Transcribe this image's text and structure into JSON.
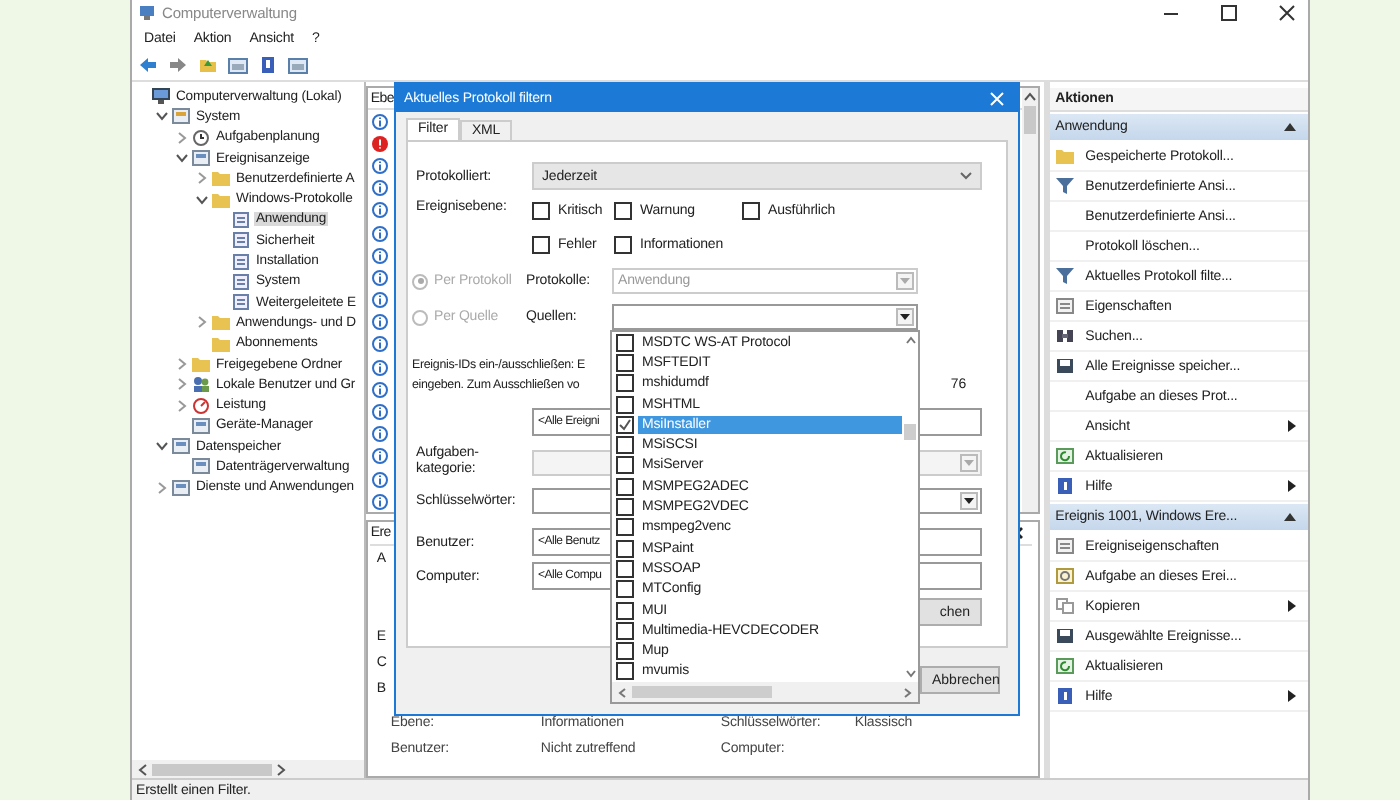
{
  "window": {
    "title": "Computerverwaltung"
  },
  "menu": [
    "Datei",
    "Aktion",
    "Ansicht",
    "?"
  ],
  "toolbar": [
    {
      "kind": "back"
    },
    {
      "kind": "forward"
    },
    {
      "kind": "folder"
    },
    {
      "kind": "console"
    },
    {
      "kind": "help"
    },
    {
      "kind": "console"
    }
  ],
  "tree": [
    {
      "label": "Computerverwaltung (Lokal)",
      "kind": "computer",
      "selected": false,
      "children": [
        {
          "label": "System",
          "kind": "tools",
          "expanded": true,
          "selected": false,
          "children": [
            {
              "label": "Aufgabenplanung",
              "kind": "clock",
              "expanded": false,
              "selected": false
            },
            {
              "label": "Ereignisanzeige",
              "kind": "viewer",
              "expanded": true,
              "selected": false,
              "children": [
                {
                  "label": "Benutzerdefinierte A",
                  "kind": "folder",
                  "expanded": false,
                  "selected": false
                },
                {
                  "label": "Windows-Protokolle",
                  "kind": "folder",
                  "expanded": true,
                  "selected": false,
                  "children": [
                    {
                      "label": "Anwendung",
                      "kind": "log",
                      "selected": true
                    },
                    {
                      "label": "Sicherheit",
                      "kind": "log",
                      "selected": false
                    },
                    {
                      "label": "Installation",
                      "kind": "log",
                      "selected": false
                    },
                    {
                      "label": "System",
                      "kind": "log",
                      "selected": false
                    },
                    {
                      "label": "Weitergeleitete E",
                      "kind": "log",
                      "selected": false
                    }
                  ]
                },
                {
                  "label": "Anwendungs- und D",
                  "kind": "folder",
                  "expanded": false,
                  "selected": false
                },
                {
                  "label": "Abonnements",
                  "kind": "folder",
                  "selected": false
                }
              ]
            },
            {
              "label": "Freigegebene Ordner",
              "kind": "folder",
              "expanded": false,
              "selected": false
            },
            {
              "label": "Lokale Benutzer und Gr",
              "kind": "users",
              "expanded": false,
              "selected": false
            },
            {
              "label": "Leistung",
              "kind": "gauge",
              "expanded": false,
              "selected": false
            },
            {
              "label": "Geräte-Manager",
              "kind": "device",
              "selected": false
            }
          ]
        },
        {
          "label": "Datenspeicher",
          "kind": "storage",
          "expanded": true,
          "selected": false,
          "children": [
            {
              "label": "Datenträgerverwaltung",
              "kind": "device",
              "selected": false
            }
          ]
        },
        {
          "label": "Dienste und Anwendungen",
          "kind": "storage",
          "expanded": false,
          "selected": false
        }
      ]
    }
  ],
  "event_list": {
    "header": "Ebe",
    "rows": [
      {
        "kind": "info"
      },
      {
        "kind": "error"
      },
      {
        "kind": "info"
      },
      {
        "kind": "info"
      },
      {
        "kind": "info"
      },
      {
        "kind": "info"
      },
      {
        "kind": "info"
      },
      {
        "kind": "info"
      },
      {
        "kind": "info"
      },
      {
        "kind": "info"
      },
      {
        "kind": "info"
      },
      {
        "kind": "info"
      },
      {
        "kind": "info"
      },
      {
        "kind": "info"
      },
      {
        "kind": "info"
      },
      {
        "kind": "info"
      },
      {
        "kind": "info"
      },
      {
        "kind": "info"
      }
    ]
  },
  "detail": {
    "tab": "Ere",
    "subtab": "A",
    "side_letters": [
      "E",
      "C",
      "B"
    ],
    "fields": [
      {
        "label": "Ebene:",
        "value": "Informationen",
        "label2": "Schlüsselwörter:",
        "value2": "Klassisch"
      },
      {
        "label": "Benutzer:",
        "value": "Nicht zutreffend",
        "label2": "Computer:"
      }
    ]
  },
  "actions": {
    "title": "Aktionen",
    "sections": [
      {
        "title": "Anwendung",
        "expanded": true,
        "items": [
          {
            "label": "Gespeicherte Protokoll...",
            "kind": "folder",
            "submenu": false
          },
          {
            "label": "Benutzerdefinierte Ansi...",
            "kind": "filter",
            "submenu": false
          },
          {
            "label": "Benutzerdefinierte Ansi...",
            "kind": "none",
            "submenu": false
          },
          {
            "label": "Protokoll löschen...",
            "kind": "none",
            "submenu": false
          },
          {
            "label": "Aktuelles Protokoll filte...",
            "kind": "filter",
            "submenu": false
          },
          {
            "label": "Eigenschaften",
            "kind": "props",
            "submenu": false
          },
          {
            "label": "Suchen...",
            "kind": "search",
            "submenu": false
          },
          {
            "label": "Alle Ereignisse speicher...",
            "kind": "save",
            "submenu": false
          },
          {
            "label": "Aufgabe an dieses Prot...",
            "kind": "none",
            "submenu": false
          },
          {
            "label": "Ansicht",
            "kind": "none",
            "submenu": true
          },
          {
            "label": "Aktualisieren",
            "kind": "refresh",
            "submenu": false
          },
          {
            "label": "Hilfe",
            "kind": "help",
            "submenu": true
          }
        ]
      },
      {
        "title": "Ereignis 1001, Windows Ere...",
        "expanded": true,
        "items": [
          {
            "label": "Ereigniseigenschaften",
            "kind": "props",
            "submenu": false
          },
          {
            "label": "Aufgabe an dieses Erei...",
            "kind": "task",
            "submenu": false
          },
          {
            "label": "Kopieren",
            "kind": "copy",
            "submenu": true
          },
          {
            "label": "Ausgewählte Ereignisse...",
            "kind": "save",
            "submenu": false
          },
          {
            "label": "Aktualisieren",
            "kind": "refresh",
            "submenu": false
          },
          {
            "label": "Hilfe",
            "kind": "help",
            "submenu": true
          }
        ]
      }
    ]
  },
  "dialog": {
    "title": "Aktuelles Protokoll filtern",
    "tabs": [
      {
        "label": "Filter",
        "selected": true
      },
      {
        "label": "XML",
        "selected": false
      }
    ],
    "logged": {
      "label": "Protokolliert:",
      "value": "Jederzeit"
    },
    "levels": {
      "label": "Ereignisebene:",
      "options": [
        {
          "label": "Kritisch",
          "checked": false
        },
        {
          "label": "Warnung",
          "checked": false
        },
        {
          "label": "Ausführlich",
          "checked": false
        },
        {
          "label": "Fehler",
          "checked": false
        },
        {
          "label": "Informationen",
          "checked": false
        }
      ]
    },
    "source_modes": [
      {
        "label": "Per Protokoll",
        "selected": true,
        "disabled": true,
        "field_label": "Protokolle:",
        "value": "Anwendung"
      },
      {
        "label": "Per Quelle",
        "selected": false,
        "disabled": true,
        "field_label": "Quellen:"
      }
    ],
    "event_ids": {
      "lines": [
        "Ereignis-IDs ein-/ausschließen: E",
        "eingeben. Zum Ausschließen vo"
      ],
      "fragment": "76",
      "value": "<Alle Ereigni"
    },
    "task_category": {
      "label": "Aufgaben-kategorie:"
    },
    "keywords": {
      "label": "Schlüsselwörter:"
    },
    "user": {
      "label": "Benutzer:",
      "value": "<Alle Benutz"
    },
    "computer": {
      "label": "Computer:",
      "value": "<Alle Compu"
    },
    "clear_button": "chen",
    "cancel_button": "Abbrechen",
    "source_list": [
      {
        "label": "MSDTC WS-AT Protocol",
        "checked": false,
        "selected": false
      },
      {
        "label": "MSFTEDIT",
        "checked": false,
        "selected": false
      },
      {
        "label": "mshidumdf",
        "checked": false,
        "selected": false
      },
      {
        "label": "MSHTML",
        "checked": false,
        "selected": false
      },
      {
        "label": "MsiInstaller",
        "checked": true,
        "selected": true
      },
      {
        "label": "MSiSCSI",
        "checked": false,
        "selected": false
      },
      {
        "label": "MsiServer",
        "checked": false,
        "selected": false
      },
      {
        "label": "MSMPEG2ADEC",
        "checked": false,
        "selected": false
      },
      {
        "label": "MSMPEG2VDEC",
        "checked": false,
        "selected": false
      },
      {
        "label": "msmpeg2venc",
        "checked": false,
        "selected": false
      },
      {
        "label": "MSPaint",
        "checked": false,
        "selected": false
      },
      {
        "label": "MSSOAP",
        "checked": false,
        "selected": false
      },
      {
        "label": "MTConfig",
        "checked": false,
        "selected": false
      },
      {
        "label": "MUI",
        "checked": false,
        "selected": false
      },
      {
        "label": "Multimedia-HEVCDECODER",
        "checked": false,
        "selected": false
      },
      {
        "label": "Mup",
        "checked": false,
        "selected": false
      },
      {
        "label": "mvumis",
        "checked": false,
        "selected": false
      }
    ]
  },
  "status_bar": "Erstellt einen Filter."
}
